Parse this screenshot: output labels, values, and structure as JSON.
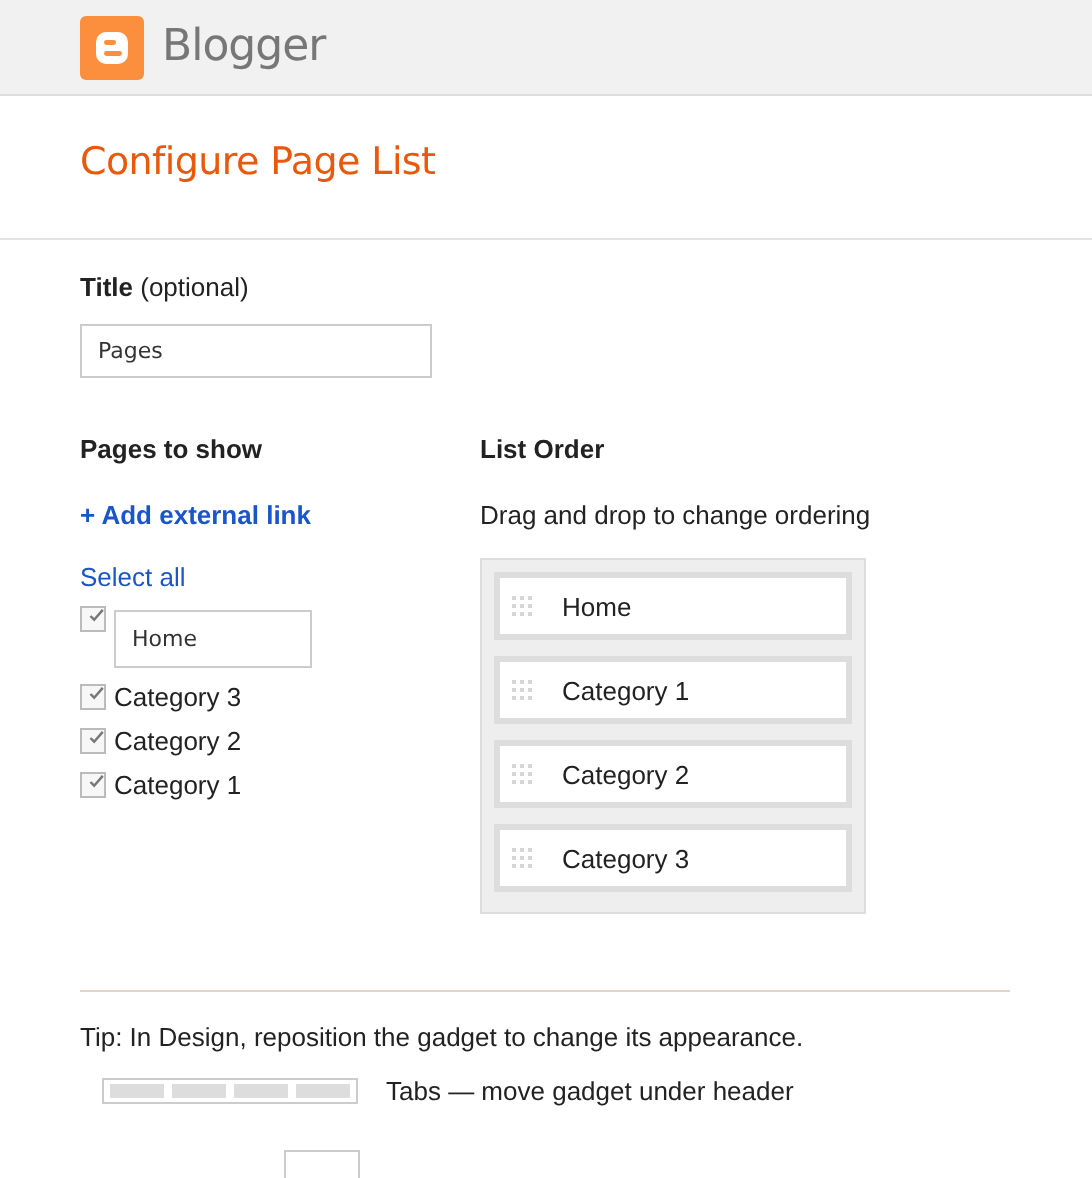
{
  "header": {
    "logo_text": "Blogger"
  },
  "page_title": "Configure Page List",
  "title_field": {
    "label": "Title",
    "label_note": "(optional)",
    "value": "Pages"
  },
  "pages_to_show": {
    "heading": "Pages to show",
    "add_link": "+ Add external link",
    "select_all": "Select all",
    "items": [
      {
        "kind": "field",
        "label": "Home",
        "checked": true
      },
      {
        "kind": "label",
        "label": "Category 3",
        "checked": true
      },
      {
        "kind": "label",
        "label": "Category 2",
        "checked": true
      },
      {
        "kind": "label",
        "label": "Category 1",
        "checked": true
      }
    ]
  },
  "list_order": {
    "heading": "List Order",
    "hint": "Drag and drop to change ordering",
    "items": [
      "Home",
      "Category 1",
      "Category 2",
      "Category 3"
    ]
  },
  "tip": {
    "text": "Tip: In Design, reposition the gadget to change its appearance.",
    "options": [
      {
        "kind": "tabs",
        "label": "Tabs — move gadget under header"
      },
      {
        "kind": "list"
      }
    ]
  }
}
